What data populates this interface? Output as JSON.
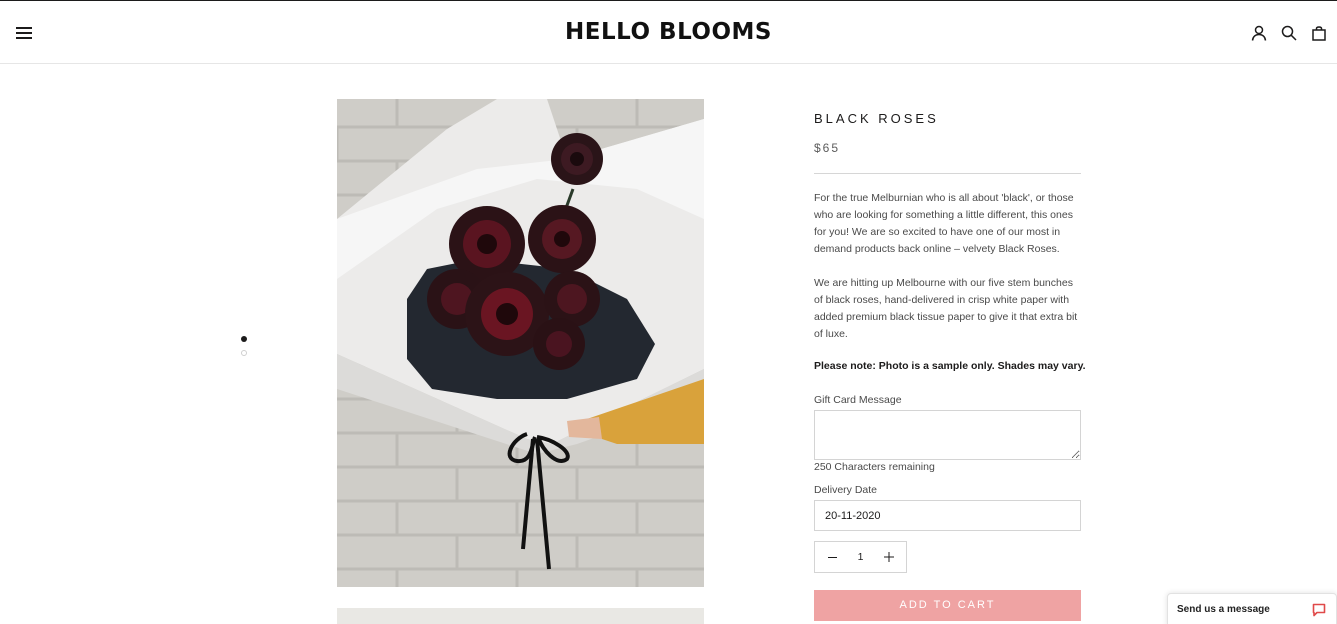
{
  "header": {
    "logo": "HELLO BLOOMS",
    "icons": [
      "menu-icon",
      "account-icon",
      "search-icon",
      "cart-icon"
    ]
  },
  "gallery": {
    "image_count": 2,
    "active_index": 0
  },
  "product": {
    "title": "BLACK ROSES",
    "price": "$65",
    "description": [
      "For the true Melburnian who is all about 'black', or those who are looking for something a little different, this ones for you! We are so excited to have one of our most in demand products back online – velvety Black Roses.",
      "We are hitting up Melbourne with our five stem bunches of black roses, hand-delivered in crisp white paper with added premium black tissue paper to give it that extra bit of luxe."
    ],
    "note": "Please note: Photo is a sample only. Shades may vary."
  },
  "form": {
    "gift_label": "Gift Card Message",
    "gift_value": "",
    "chars_remaining": "250 Characters remaining",
    "delivery_label": "Delivery Date",
    "delivery_value": "20-11-2020",
    "quantity": "1",
    "add_to_cart": "ADD TO CART"
  },
  "chat": {
    "label": "Send us a message"
  },
  "colors": {
    "accent_button": "#efa3a3",
    "chat_icon": "#e04a4a",
    "text_dark": "#1c1b1b"
  }
}
